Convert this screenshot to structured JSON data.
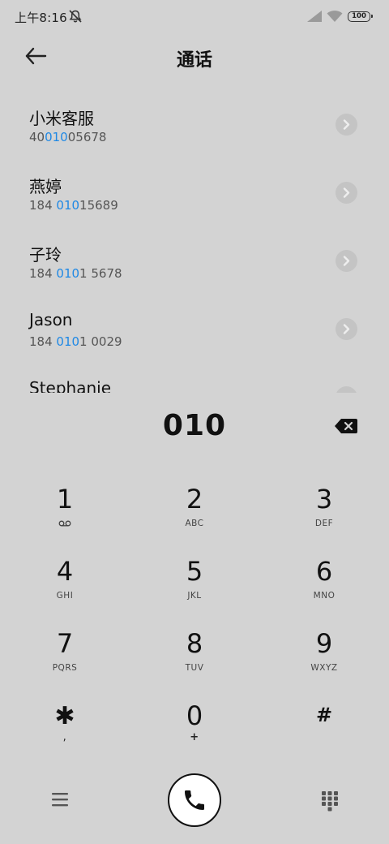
{
  "status_bar": {
    "time": "上午8:16",
    "battery": "100",
    "icons": [
      "mute-icon",
      "signal-icon",
      "wifi-icon",
      "battery-icon"
    ]
  },
  "header": {
    "title": "通话",
    "back_icon": "back-arrow-icon"
  },
  "search": {
    "query": "010",
    "highlight_color": "#1e88e5"
  },
  "contacts": [
    {
      "name": "小米客服",
      "number_parts": [
        "40",
        "010",
        "05678"
      ]
    },
    {
      "name": "燕婷",
      "number_parts": [
        "184 ",
        "010",
        "15689"
      ]
    },
    {
      "name": "子玲",
      "number_parts": [
        "184 ",
        "010",
        "1 5678"
      ]
    },
    {
      "name": "Jason",
      "number_parts": [
        "184 ",
        "010",
        "1 0029"
      ]
    },
    {
      "name": "Stephanie",
      "number_parts": [
        "",
        "",
        ""
      ]
    }
  ],
  "dialer": {
    "display": "010",
    "keys": [
      {
        "digit": "1",
        "letters": ""
      },
      {
        "digit": "2",
        "letters": "ABC"
      },
      {
        "digit": "3",
        "letters": "DEF"
      },
      {
        "digit": "4",
        "letters": "GHI"
      },
      {
        "digit": "5",
        "letters": "JKL"
      },
      {
        "digit": "6",
        "letters": "MNO"
      },
      {
        "digit": "7",
        "letters": "PQRS"
      },
      {
        "digit": "8",
        "letters": "TUV"
      },
      {
        "digit": "9",
        "letters": "WXYZ"
      },
      {
        "digit": "✱",
        "letters": ","
      },
      {
        "digit": "0",
        "letters": "+"
      },
      {
        "digit": "#",
        "letters": ""
      }
    ]
  },
  "bottom_bar": {
    "icons": [
      "menu-icon",
      "phone-icon",
      "keypad-icon"
    ]
  }
}
